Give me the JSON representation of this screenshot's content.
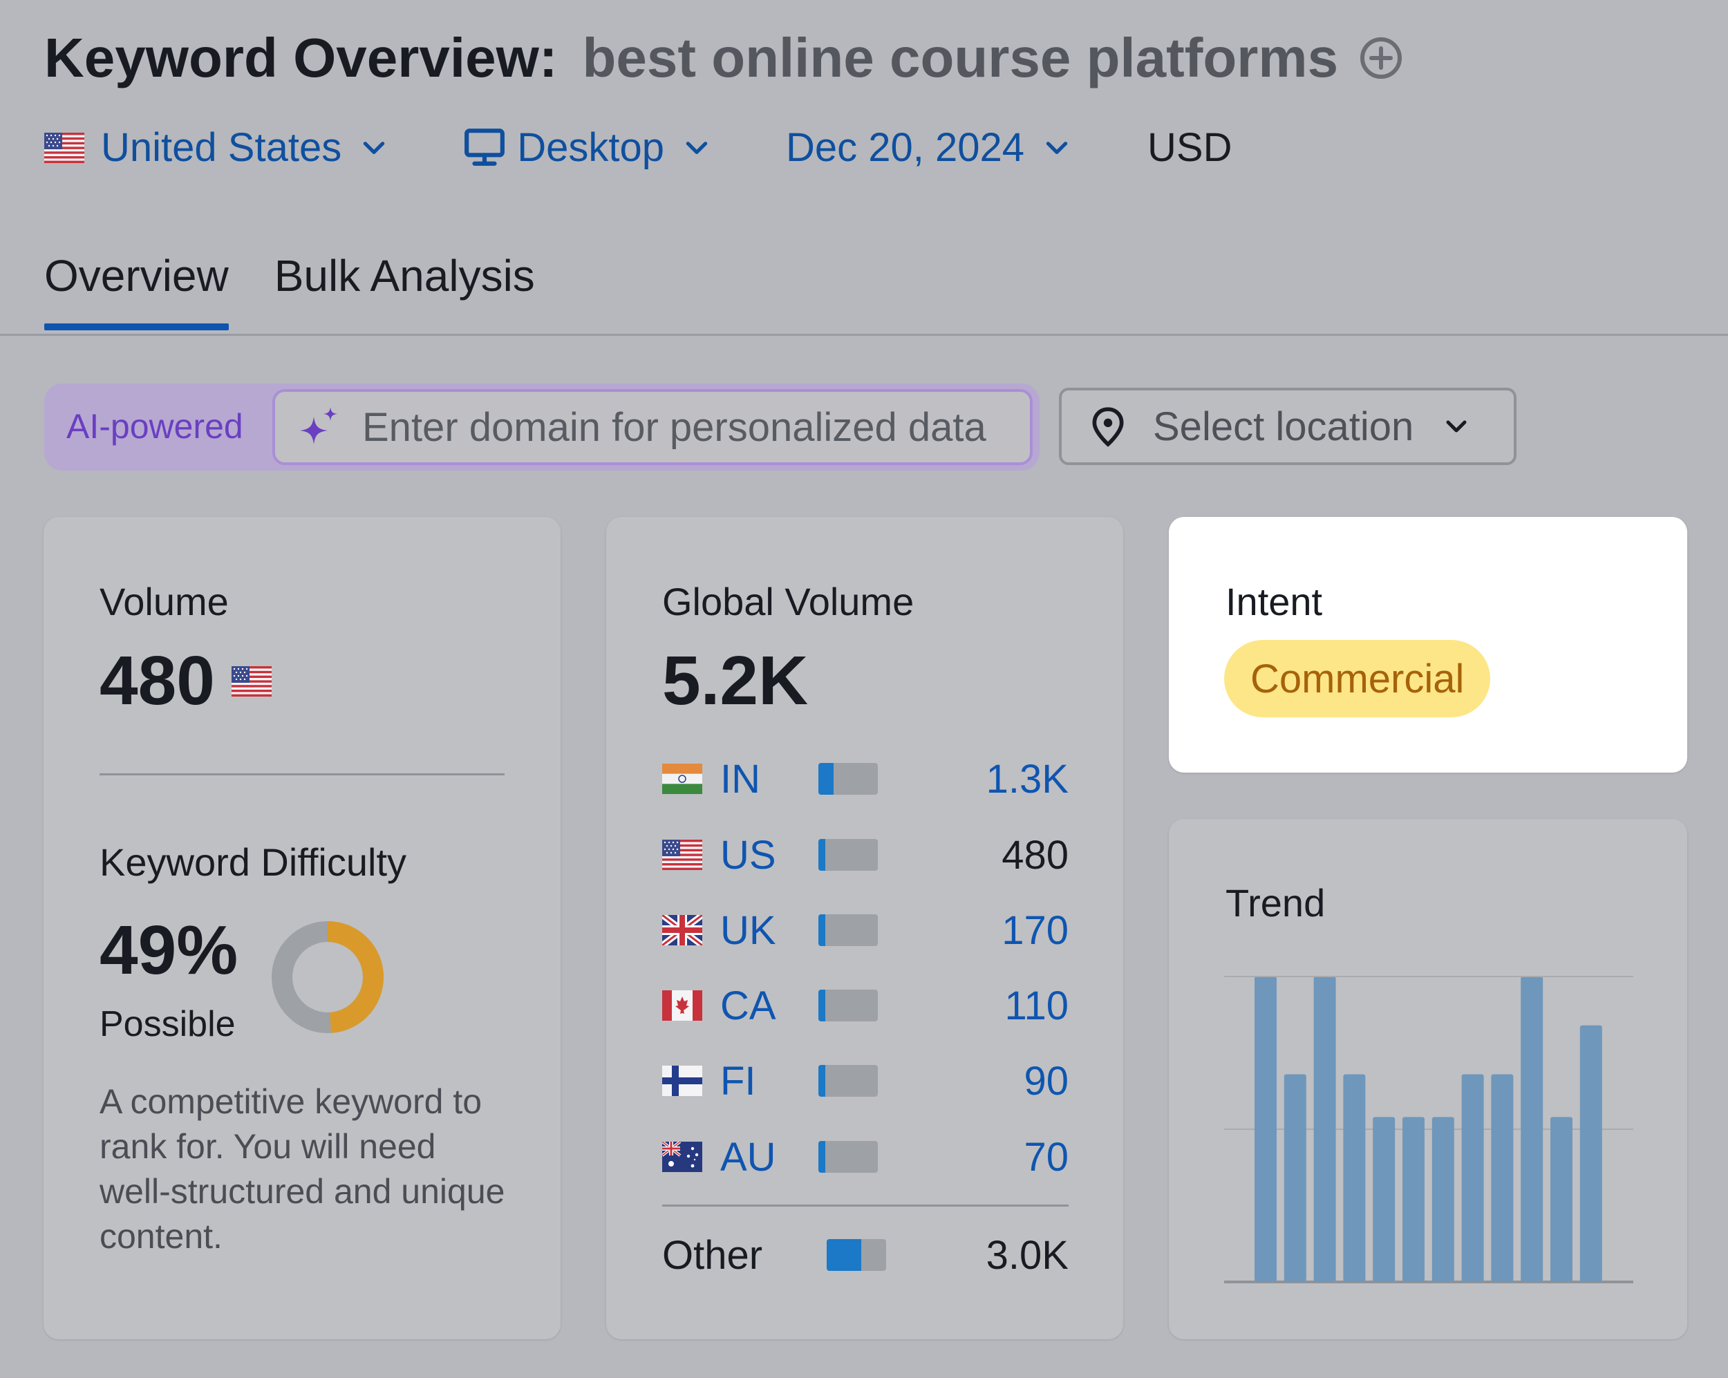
{
  "header": {
    "title": "Keyword Overview:",
    "keyword": "best online course platforms",
    "add_icon": "plus-circle-icon"
  },
  "filters": {
    "country": "United States",
    "device": "Desktop",
    "date": "Dec 20, 2024",
    "currency": "USD"
  },
  "tabs": [
    {
      "label": "Overview",
      "active": true
    },
    {
      "label": "Bulk Analysis",
      "active": false
    }
  ],
  "ai_search": {
    "badge": "AI-powered",
    "placeholder": "Enter domain for personalized data",
    "icon": "sparkle-icon"
  },
  "location_select": {
    "placeholder": "Select location",
    "icon": "location-pin-icon"
  },
  "volume_card": {
    "label": "Volume",
    "value": "480",
    "kd_label": "Keyword Difficulty",
    "kd_value": "49%",
    "kd_level": "Possible",
    "kd_percent": 49,
    "kd_description": "A competitive keyword to rank for. You will need well-structured and unique content."
  },
  "global_volume_card": {
    "label": "Global Volume",
    "value": "5.2K",
    "countries": [
      {
        "code": "IN",
        "value": "1.3K",
        "share": 0.25,
        "link": true
      },
      {
        "code": "US",
        "value": "480",
        "share": 0.09,
        "link": false
      },
      {
        "code": "UK",
        "value": "170",
        "share": 0.05,
        "link": true
      },
      {
        "code": "CA",
        "value": "110",
        "share": 0.05,
        "link": true
      },
      {
        "code": "FI",
        "value": "90",
        "share": 0.05,
        "link": true
      },
      {
        "code": "AU",
        "value": "70",
        "share": 0.05,
        "link": true
      }
    ],
    "other": {
      "label": "Other",
      "value": "3.0K",
      "share": 0.58
    }
  },
  "intent_card": {
    "label": "Intent",
    "badge": "Commercial"
  },
  "trend_card": {
    "label": "Trend"
  },
  "chart_data": {
    "type": "bar",
    "values": [
      100,
      68,
      100,
      68,
      54,
      54,
      54,
      68,
      68,
      100,
      54,
      84
    ],
    "ylim": [
      0,
      100
    ],
    "grid": true,
    "bar_color": "#6f97bb"
  },
  "colors": {
    "accent_blue": "#0f55b0",
    "kd_fill": "#d99a2b",
    "kd_track": "#9ea1a6",
    "intent_bg": "#fde687",
    "intent_text": "#a6620b",
    "ai_purple": "#6a3fc1"
  }
}
